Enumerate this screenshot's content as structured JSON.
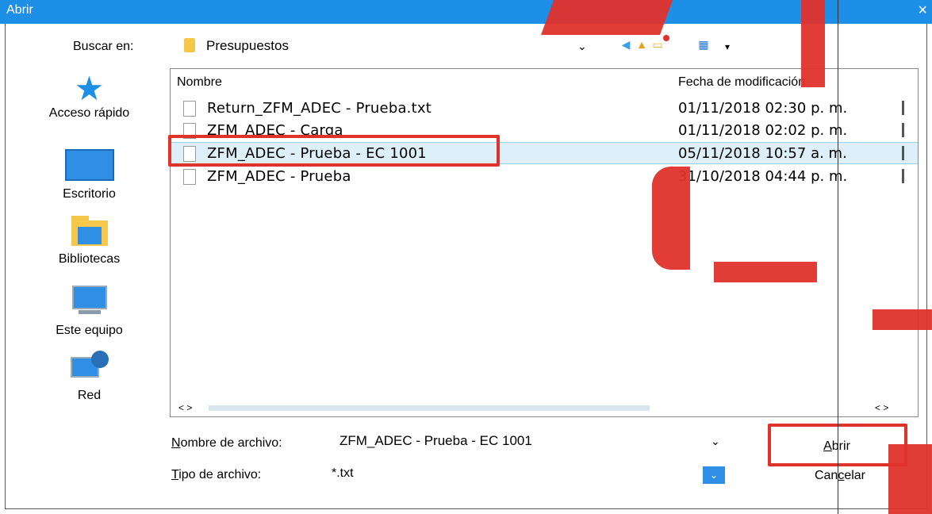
{
  "window": {
    "title": "Abrir",
    "close_glyph": "×"
  },
  "lookin": {
    "label": "Buscar en:",
    "value": "Presupuestos",
    "chevron": "⌄"
  },
  "toolbar": {
    "back_icon": "back-arrow-icon",
    "up_icon": "up-folder-icon",
    "new_folder_icon": "new-folder-icon",
    "view_icon": "view-menu-icon"
  },
  "places": [
    {
      "label": "Acceso rápido",
      "icon": "star-icon"
    },
    {
      "label": "Escritorio",
      "icon": "desktop-icon"
    },
    {
      "label": "Bibliotecas",
      "icon": "libraries-icon"
    },
    {
      "label": "Este equipo",
      "icon": "computer-icon"
    },
    {
      "label": "Red",
      "icon": "network-icon"
    }
  ],
  "columns": {
    "name": "Nombre",
    "date": "Fecha de modificación"
  },
  "files": [
    {
      "name": "Return_ZFM_ADEC - Prueba.txt",
      "date": "01/11/2018 02:30",
      "ampm": "p. m."
    },
    {
      "name": "ZFM_ADEC - Carga",
      "date": "01/11/2018 02:02",
      "ampm": "p. m."
    },
    {
      "name": "ZFM_ADEC - Prueba - EC 1001",
      "date": "05/11/2018 10:57",
      "ampm": "a. m.",
      "selected": true
    },
    {
      "name": "ZFM_ADEC - Prueba",
      "date": "31/10/2018 04:44",
      "ampm": "p. m."
    }
  ],
  "filename": {
    "label_first": "N",
    "label_rest": "ombre de archivo:",
    "value": "ZFM_ADEC - Prueba - EC 1001"
  },
  "filetype": {
    "label_first": "T",
    "label_rest": "ipo de archivo:",
    "value": "*.txt"
  },
  "buttons": {
    "open_first": "A",
    "open_rest": "brir",
    "cancel_pre": "Can",
    "cancel_u": "c",
    "cancel_post": "elar"
  },
  "colors": {
    "title_bar": "#1e8fe6",
    "highlight": "#e0322b",
    "selection": "#ddf0fa"
  }
}
